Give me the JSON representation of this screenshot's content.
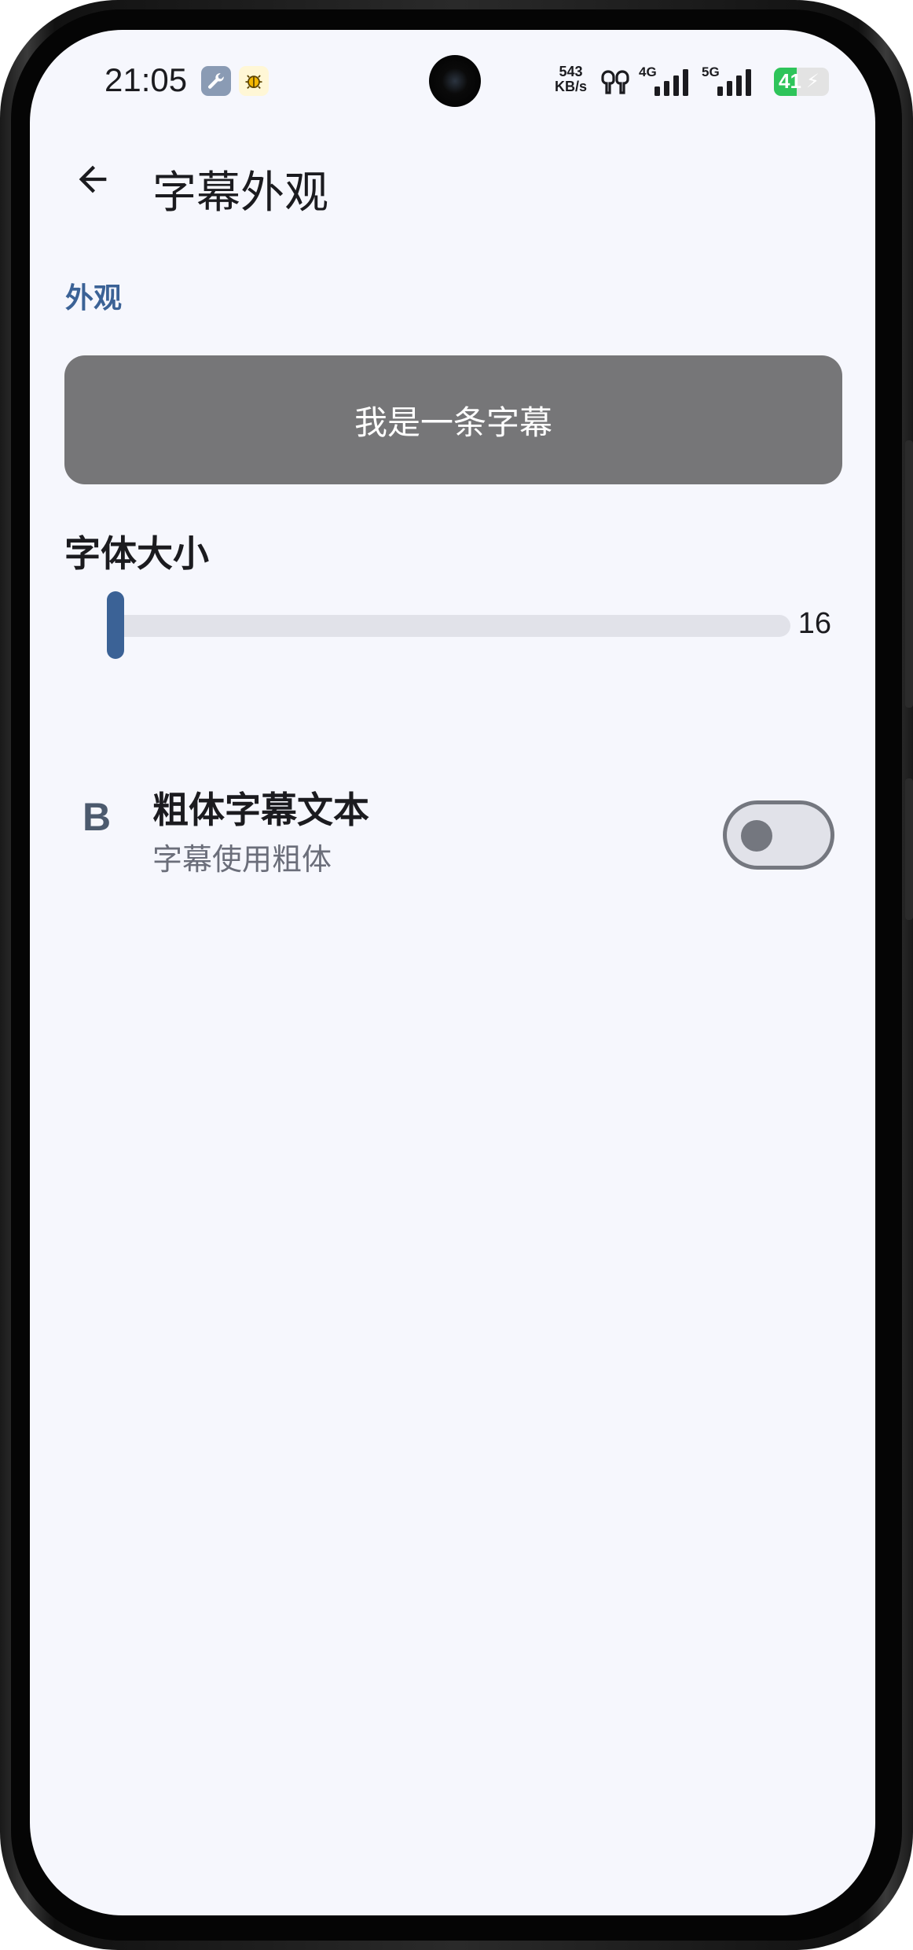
{
  "status_bar": {
    "time": "21:05",
    "notification_icons": [
      "wrench-icon",
      "bug-icon"
    ],
    "net_speed_value": "543",
    "net_speed_unit": "KB/s",
    "signal_1_label": "4G",
    "signal_2_label": "5G",
    "battery_level": "41",
    "battery_charging": true,
    "battery_color": "#2ec45a"
  },
  "app_bar": {
    "back_icon": "arrow-back-icon",
    "title": "字幕外观"
  },
  "section": {
    "header": "外观"
  },
  "preview": {
    "text": "我是一条字幕",
    "background_color": "#767678"
  },
  "font_size": {
    "label": "字体大小",
    "value": "16",
    "slider_fraction": 0.0,
    "accent_color": "#3b6296"
  },
  "bold_setting": {
    "icon": "bold-icon",
    "icon_glyph": "B",
    "title": "粗体字幕文本",
    "subtitle": "字幕使用粗体",
    "enabled": false
  }
}
